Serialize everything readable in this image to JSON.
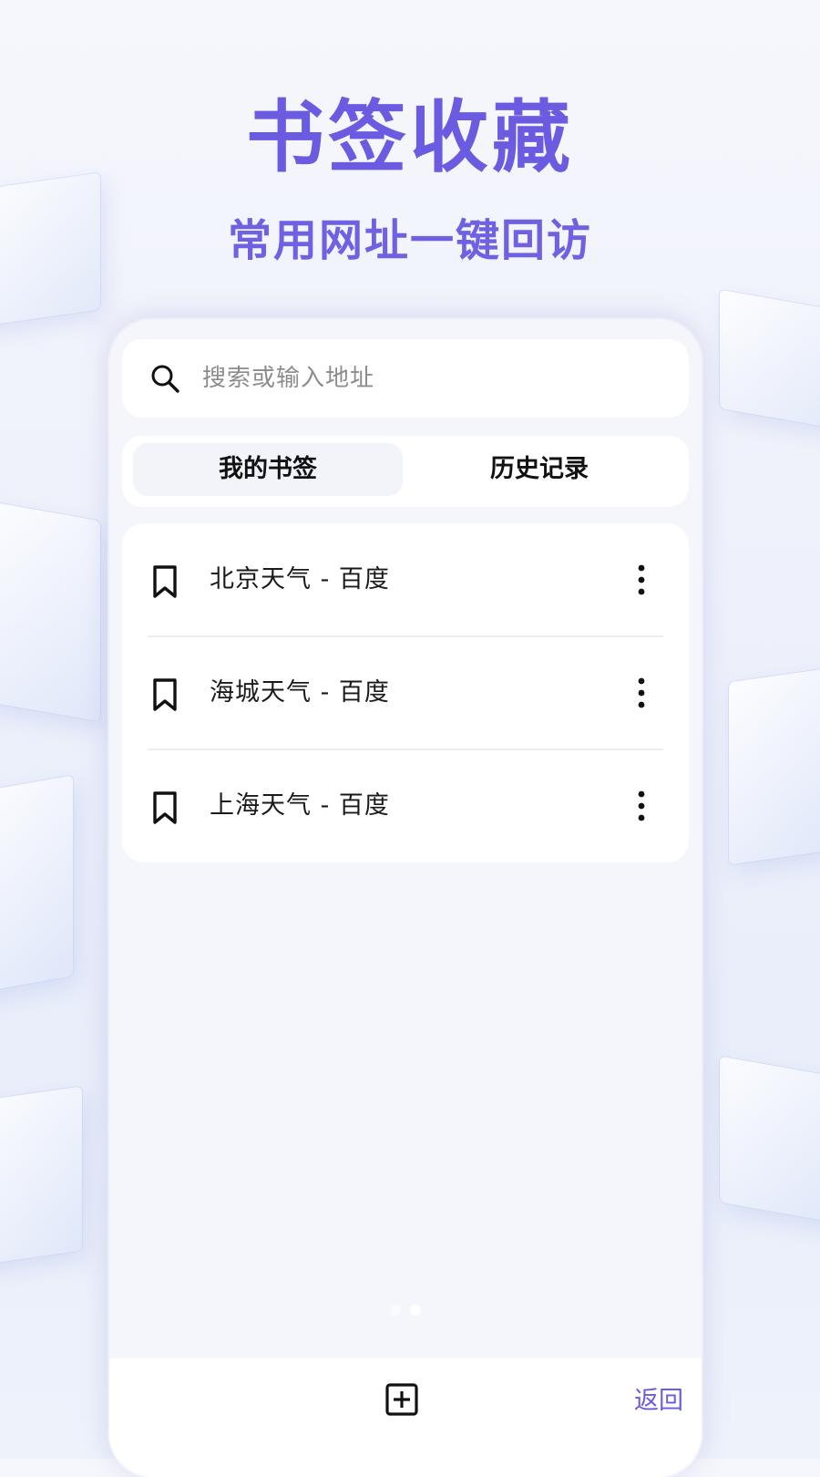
{
  "hero": {
    "title": "书签收藏",
    "subtitle": "常用网址一键回访"
  },
  "search": {
    "placeholder": "搜索或输入地址",
    "icon": "search-icon"
  },
  "tabs": [
    {
      "label": "我的书签",
      "active": true
    },
    {
      "label": "历史记录",
      "active": false
    }
  ],
  "bookmarks": [
    {
      "title": "北京天气 - 百度",
      "icon": "bookmark-icon"
    },
    {
      "title": "海城天气 - 百度",
      "icon": "bookmark-icon"
    },
    {
      "title": "上海天气 - 百度",
      "icon": "bookmark-icon"
    }
  ],
  "bottom_bar": {
    "add_icon": "add-square-icon",
    "back_label": "返回"
  },
  "page_indicator": {
    "count": 2,
    "active_index": 1
  },
  "colors": {
    "accent": "#6a5be0",
    "phone_bg": "#f4f6fb",
    "card_bg": "#ffffff"
  }
}
